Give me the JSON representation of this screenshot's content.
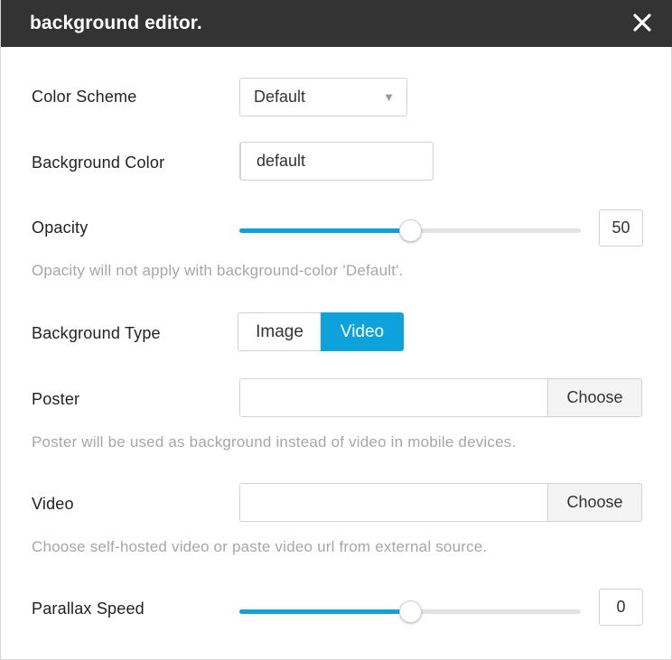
{
  "dialog": {
    "title": "background editor.",
    "close_icon": "close-icon"
  },
  "color_scheme": {
    "label": "Color Scheme",
    "selected": "Default",
    "arrow": "▼"
  },
  "background_color": {
    "label": "Background Color",
    "value": "default"
  },
  "opacity": {
    "label": "Opacity",
    "value": "50",
    "fraction": 0.5,
    "hint": "Opacity will not apply with background-color 'Default'."
  },
  "background_type": {
    "label": "Background Type",
    "options": [
      "Image",
      "Video"
    ],
    "selected": "Video"
  },
  "poster": {
    "label": "Poster",
    "value": "",
    "button": "Choose",
    "hint": "Poster will be used as background instead of video in mobile devices."
  },
  "video": {
    "label": "Video",
    "value": "",
    "button": "Choose",
    "hint": "Choose self-hosted video or paste video url from external source."
  },
  "parallax_speed": {
    "label": "Parallax Speed",
    "value": "0",
    "fraction": 0.5
  },
  "colors": {
    "accent": "#0ea2dd",
    "titlebar": "#333333",
    "hint_text": "#a7a7a7"
  }
}
